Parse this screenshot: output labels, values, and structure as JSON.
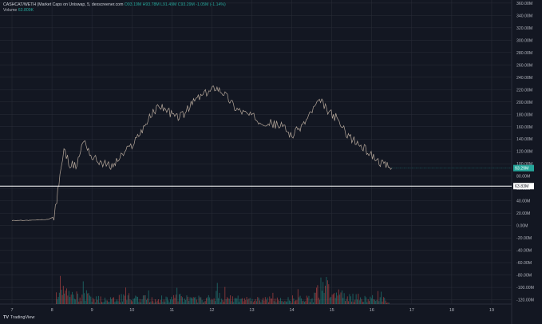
{
  "legend": {
    "symbol": "CASHCAT/WETH (Market Caps on Uniswap, 5, dexscreener.com",
    "ohlc": "O93.19M  H93.78M  L91.49M  C93.29M  -1.05M (-1.14%)",
    "volume_label": "Volume",
    "volume_value": "63.809K"
  },
  "brand": {
    "mark": "TV",
    "name": "TradingView"
  },
  "chart_data": {
    "type": "line",
    "title": "",
    "x_tick_labels": [
      "7",
      "8",
      "9",
      "10",
      "11",
      "12",
      "13",
      "14",
      "15",
      "16",
      "17",
      "18",
      "19"
    ],
    "y_tick_values": [
      360,
      340,
      320,
      300,
      280,
      260,
      240,
      220,
      200,
      180,
      160,
      140,
      120,
      100,
      80,
      60,
      40,
      20,
      0,
      -20,
      -40,
      -60,
      -80,
      -100,
      -120
    ],
    "y_unit": "M",
    "ylim": [
      -127,
      365
    ],
    "xlim": [
      6.7,
      19.5
    ],
    "grid": true,
    "price_series": [
      [
        7.0,
        8
      ],
      [
        7.5,
        8.5
      ],
      [
        7.9,
        10
      ],
      [
        8.05,
        14
      ],
      [
        8.12,
        40
      ],
      [
        8.2,
        85
      ],
      [
        8.3,
        120
      ],
      [
        8.45,
        100
      ],
      [
        8.6,
        95
      ],
      [
        8.8,
        140
      ],
      [
        9.0,
        110
      ],
      [
        9.3,
        100
      ],
      [
        9.5,
        95
      ],
      [
        9.7,
        110
      ],
      [
        10.0,
        130
      ],
      [
        10.2,
        150
      ],
      [
        10.5,
        180
      ],
      [
        10.7,
        195
      ],
      [
        10.9,
        185
      ],
      [
        11.1,
        175
      ],
      [
        11.3,
        180
      ],
      [
        11.6,
        205
      ],
      [
        11.9,
        215
      ],
      [
        12.1,
        225
      ],
      [
        12.3,
        215
      ],
      [
        12.6,
        190
      ],
      [
        12.9,
        180
      ],
      [
        13.2,
        170
      ],
      [
        13.5,
        165
      ],
      [
        13.8,
        160
      ],
      [
        14.0,
        145
      ],
      [
        14.3,
        165
      ],
      [
        14.6,
        195
      ],
      [
        14.75,
        200
      ],
      [
        14.9,
        185
      ],
      [
        15.1,
        175
      ],
      [
        15.3,
        155
      ],
      [
        15.5,
        140
      ],
      [
        15.7,
        130
      ],
      [
        15.9,
        120
      ],
      [
        16.1,
        108
      ],
      [
        16.3,
        98
      ],
      [
        16.5,
        93
      ]
    ],
    "volume_series": [
      [
        8.1,
        20
      ],
      [
        8.2,
        35
      ],
      [
        8.3,
        24
      ],
      [
        8.5,
        16
      ],
      [
        8.8,
        18
      ],
      [
        9.1,
        10
      ],
      [
        9.4,
        9
      ],
      [
        9.7,
        12
      ],
      [
        10.0,
        14
      ],
      [
        10.3,
        11
      ],
      [
        10.6,
        10
      ],
      [
        10.9,
        12
      ],
      [
        11.2,
        13
      ],
      [
        11.5,
        9
      ],
      [
        11.8,
        11
      ],
      [
        12.1,
        17
      ],
      [
        12.4,
        12
      ],
      [
        12.7,
        10
      ],
      [
        13.0,
        9
      ],
      [
        13.3,
        11
      ],
      [
        13.6,
        8
      ],
      [
        13.9,
        10
      ],
      [
        14.2,
        12
      ],
      [
        14.5,
        9
      ],
      [
        14.8,
        42
      ],
      [
        15.0,
        14
      ],
      [
        15.3,
        22
      ],
      [
        15.6,
        13
      ],
      [
        15.9,
        11
      ],
      [
        16.2,
        10
      ],
      [
        16.45,
        7
      ]
    ],
    "current_price_label": "93.29M",
    "horizontal_line": {
      "value": 63.83,
      "label": "63.83M"
    },
    "colors": {
      "up": "#26a69a",
      "down": "#ef5350",
      "background": "#131722",
      "grid": "#2a2e39",
      "text": "#b2b5be",
      "line": "#ffffff"
    }
  }
}
